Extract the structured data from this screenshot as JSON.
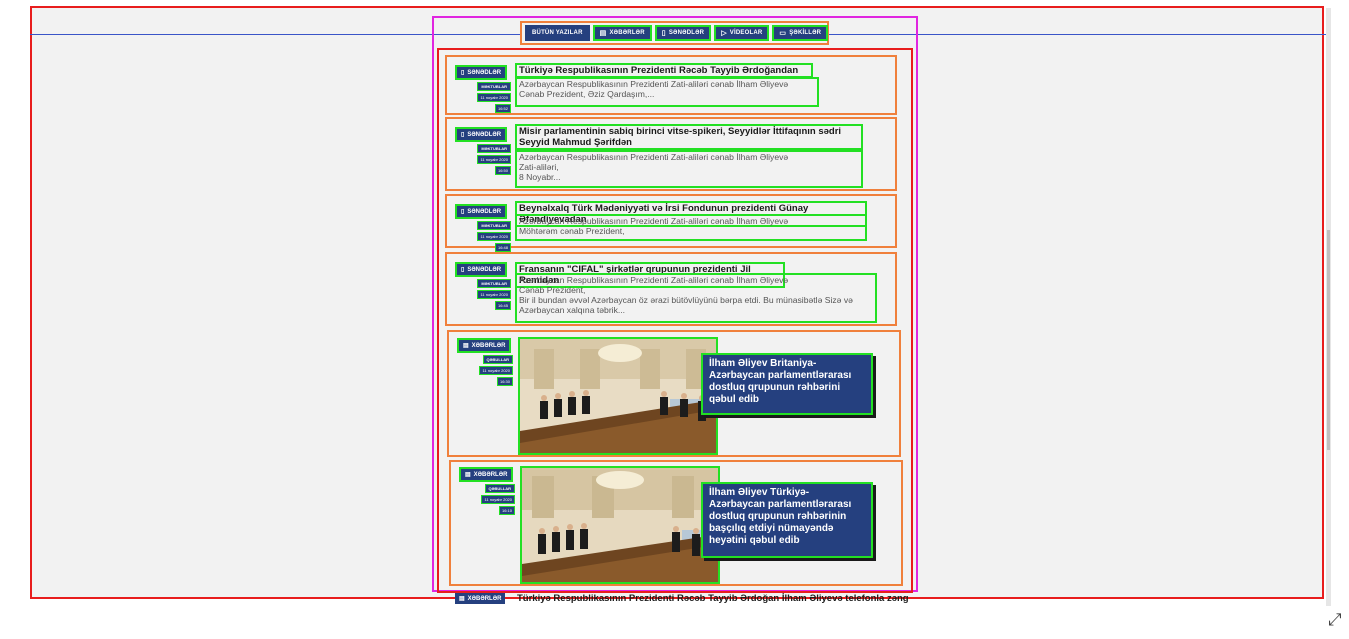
{
  "tabs": [
    {
      "label": "BÜTÜN YAZILAR",
      "icon": ""
    },
    {
      "label": "XƏBƏRLƏR",
      "icon": "news-icon"
    },
    {
      "label": "SƏNƏDLƏR",
      "icon": "document-icon"
    },
    {
      "label": "VİDEOLAR",
      "icon": "play-icon"
    },
    {
      "label": "ŞƏKİLLƏR",
      "icon": "image-icon"
    }
  ],
  "cards": [
    {
      "category": "SƏNƏDLƏR",
      "subcategory": "MƏKTUBLAR",
      "date": "11 noyabr 2020",
      "views": "16:52",
      "title": "Türkiyə Respublikasının Prezidenti Rəcəb Tayyib Ərdoğandan",
      "excerpt": [
        "Azərbaycan Respublikasının Prezidenti Zati-aliləri cənab İlham Əliyevə",
        "Cənab Prezident, Əziz Qardaşım,..."
      ]
    },
    {
      "category": "SƏNƏDLƏR",
      "subcategory": "MƏKTUBLAR",
      "date": "11 noyabr 2020",
      "views": "16:50",
      "title": "Misir parlamentinin sabiq birinci vitse-spikeri, Seyyidlər İttifaqının sədri Seyyid Mahmud Şərifdən",
      "excerpt": [
        "Azərbaycan Respublikasının Prezidenti Zati-aliləri cənab İlham Əliyevə",
        "Zati-aliləri,",
        "8 Noyabr..."
      ]
    },
    {
      "category": "SƏNƏDLƏR",
      "subcategory": "MƏKTUBLAR",
      "date": "11 noyabr 2020",
      "views": "16:48",
      "title": "Beynəlxalq Türk Mədəniyyəti və İrsi Fondunun prezidenti Günay Əfəndiyevadan",
      "excerpt": [
        "Azərbaycan Respublikasının Prezidenti Zati-aliləri cənab İlham Əliyevə",
        "Möhtərəm cənab Prezident,"
      ]
    },
    {
      "category": "SƏNƏDLƏR",
      "subcategory": "MƏKTUBLAR",
      "date": "11 noyabr 2020",
      "views": "16:45",
      "title": "Fransanın \"CIFAL\" şirkətlər qrupunun prezidenti Jil Remidən",
      "excerpt": [
        "Azərbaycan Respublikasının Prezidenti Zati-aliləri cənab İlham Əliyevə",
        "Cənab Prezident,",
        "Bir il bundan əvvəl Azərbaycan öz ərazi bütövlüyünü bərpa etdi. Bu münasibətlə Sizə və",
        "Azərbaycan xalqına təbrik..."
      ]
    }
  ],
  "photo_cards": [
    {
      "category": "XƏBƏRLƏR",
      "subcategory": "QƏBULLAR",
      "date": "11 noyabr 2020",
      "views": "16:30",
      "title": "İlham Əliyev Britaniya-Azərbaycan parlamentlərarası dostluq qrupunun rəhbərini qəbul edib"
    },
    {
      "category": "XƏBƏRLƏR",
      "subcategory": "QƏBULLAR",
      "date": "11 noyabr 2020",
      "views": "16:10",
      "title": "İlham Əliyev Türkiyə-Azərbaycan parlamentlərarası dostluq qrupunun rəhbərinin başçılıq etdiyi nümayəndə heyətini qəbul edib"
    }
  ],
  "peek": {
    "category": "XƏBƏRLƏR",
    "title": "Türkiyə Respublikasının Prezidenti Rəcəb Tayyib Ərdoğan İlham Əliyevə telefonla zəng"
  },
  "colors": {
    "accent": "#25407f",
    "card_border": "#f0803c",
    "highlight": "#23e023"
  }
}
